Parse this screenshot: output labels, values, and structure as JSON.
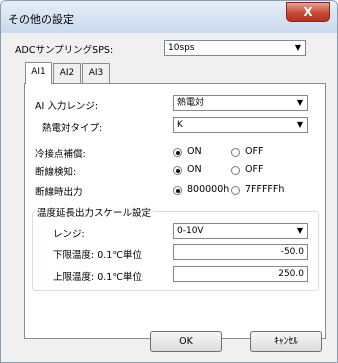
{
  "window": {
    "title": "その他の設定",
    "close_label": "X"
  },
  "adc": {
    "label": "ADCサンプリングSPS:",
    "value": "10sps"
  },
  "tabs": [
    {
      "label": "AI1",
      "active": true
    },
    {
      "label": "AI2",
      "active": false
    },
    {
      "label": "AI3",
      "active": false
    }
  ],
  "input_range": {
    "label": "AI 入力レンジ:",
    "value": "熱電対"
  },
  "thermocouple_type": {
    "label": "熱電対タイプ:",
    "value": "K"
  },
  "cold_junction": {
    "label": "冷接点補償:",
    "on": "ON",
    "off": "OFF",
    "selected": "ON"
  },
  "break_detect": {
    "label": "断線検知:",
    "on": "ON",
    "off": "OFF",
    "selected": "ON"
  },
  "break_output": {
    "label": "断線時出力",
    "opt1": "800000h",
    "opt2": "7FFFFFh",
    "selected": "800000h"
  },
  "scale_group": {
    "title": "温度延長出力スケール設定",
    "range_label": "レンジ:",
    "range_value": "0-10V",
    "lower_label": "下限温度: 0.1℃単位",
    "lower_value": "-50.0",
    "upper_label": "上限温度: 0.1℃単位",
    "upper_value": "250.0"
  },
  "buttons": {
    "ok": "OK",
    "cancel": "ｷｬﾝｾﾙ"
  },
  "icons": {
    "dropdown": "▼"
  }
}
